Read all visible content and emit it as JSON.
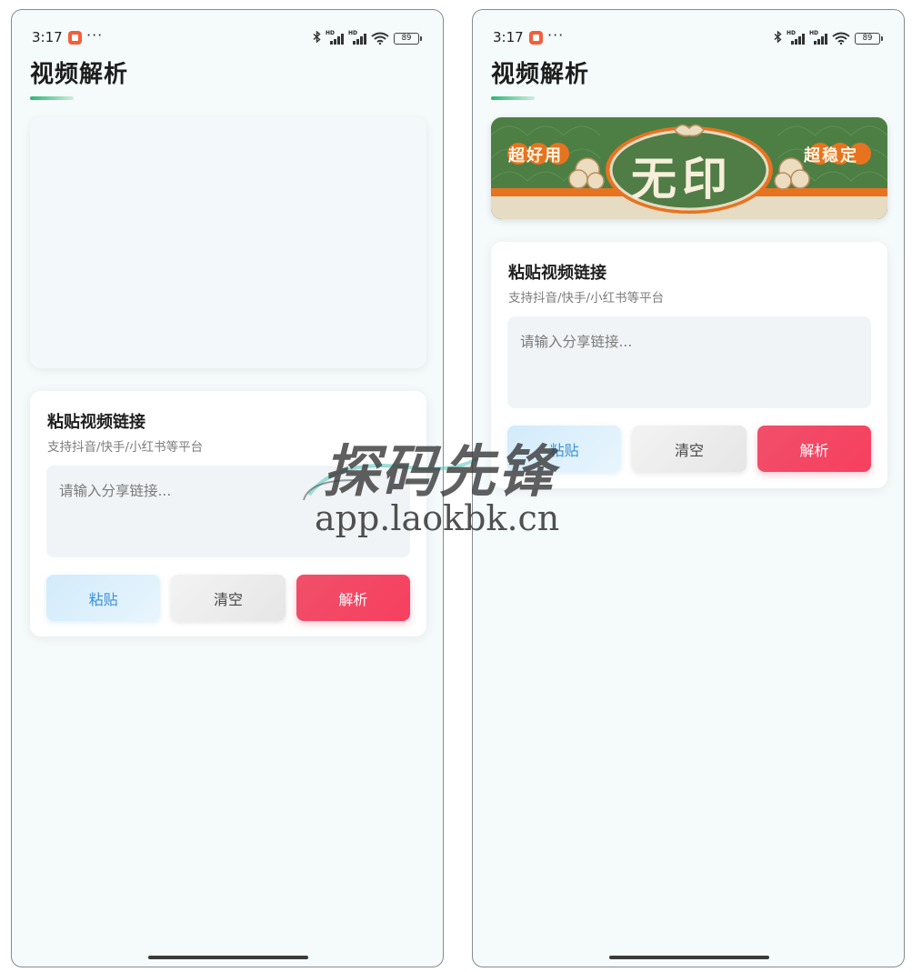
{
  "status_bar": {
    "time": "3:17",
    "dots": "···",
    "bluetooth_icon": "bluetooth-icon",
    "signal_hd_label": "HD",
    "battery_level": "89",
    "wifi_icon": "wifi-icon"
  },
  "app": {
    "title": "视频解析"
  },
  "banner": {
    "main_text": "无印",
    "left_tag": "超好用",
    "right_tag": "超稳定"
  },
  "link_card": {
    "title": "粘贴视频链接",
    "subtitle": "支持抖音/快手/小红书等平台",
    "input_placeholder": "请输入分享链接...",
    "input_value": "",
    "paste_label": "粘贴",
    "clear_label": "清空",
    "parse_label": "解析"
  },
  "watermark": {
    "title": "探码先锋",
    "url": "app.laokbk.cn"
  },
  "colors": {
    "accent_green": "#2bb673",
    "parse_red": "#f04f6a",
    "paste_blue": "#3b8fd6",
    "banner_green": "#4a7c43",
    "banner_orange": "#e8731f"
  }
}
